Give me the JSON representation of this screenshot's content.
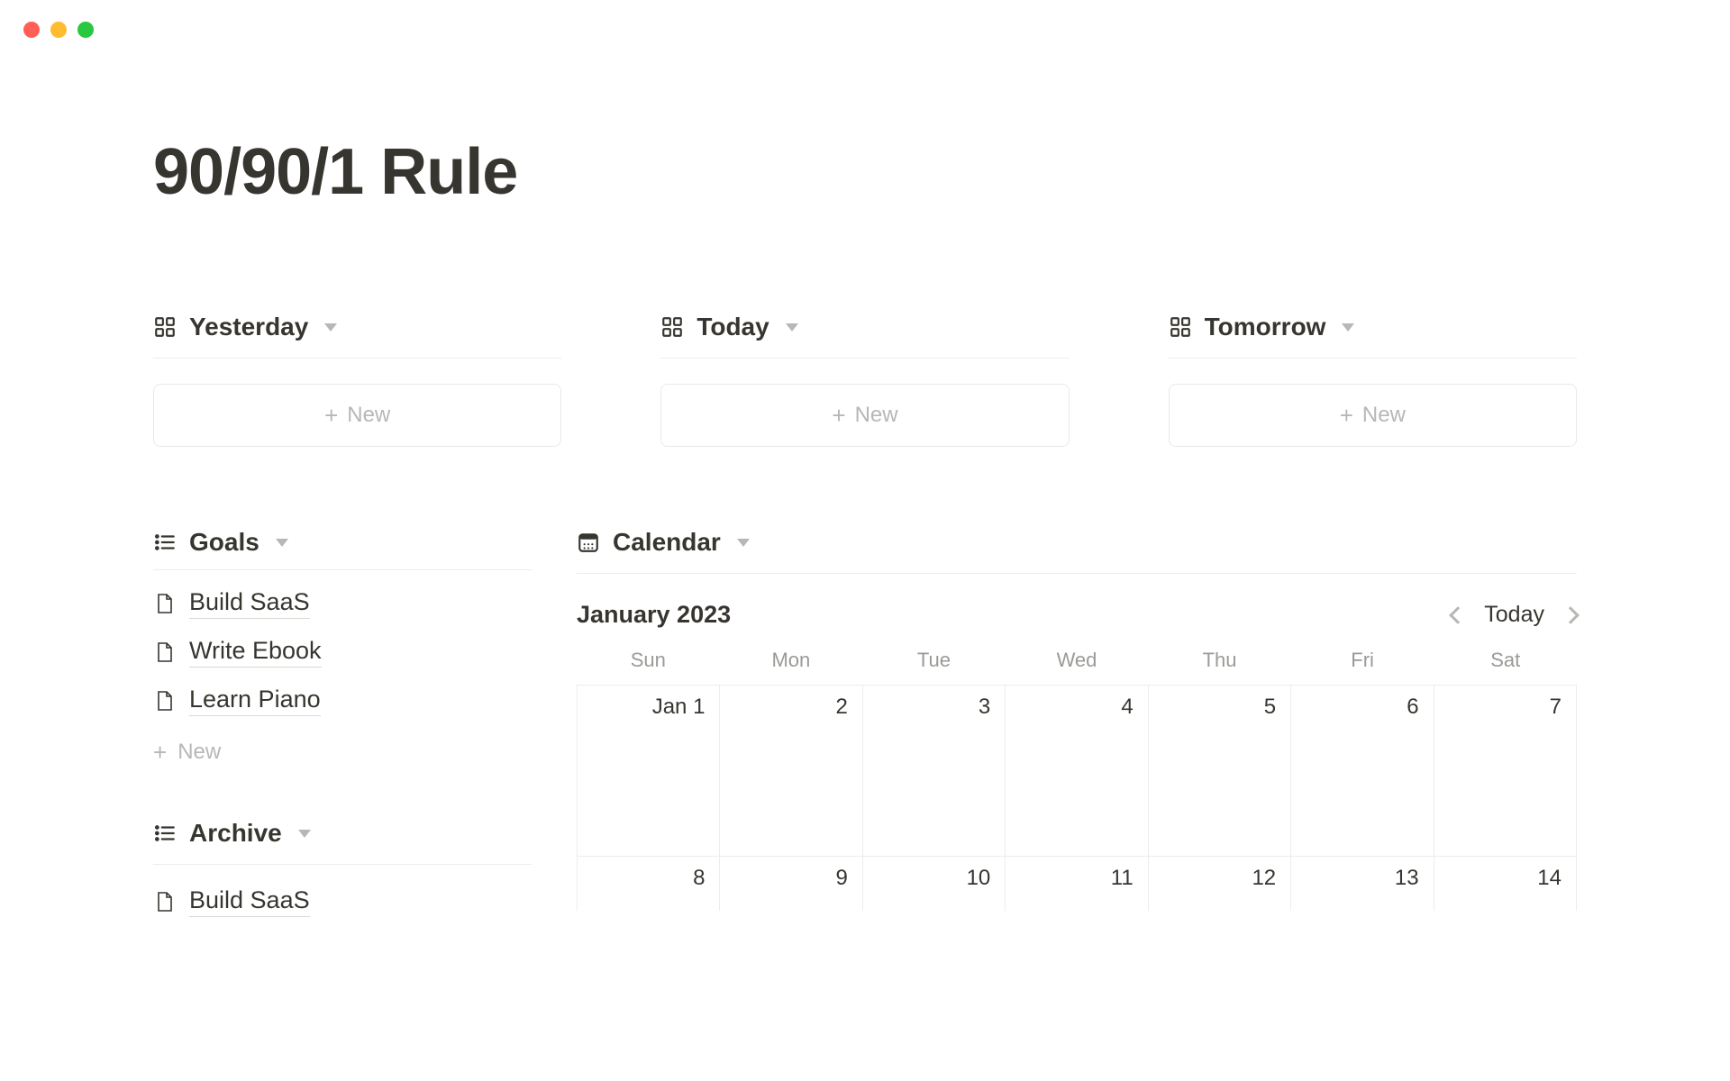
{
  "page_title": "90/90/1 Rule",
  "views": {
    "yesterday": {
      "label": "Yesterday",
      "new_label": "New"
    },
    "today": {
      "label": "Today",
      "new_label": "New"
    },
    "tomorrow": {
      "label": "Tomorrow",
      "new_label": "New"
    }
  },
  "goals": {
    "label": "Goals",
    "items": [
      {
        "title": "Build SaaS"
      },
      {
        "title": "Write Ebook"
      },
      {
        "title": "Learn Piano"
      }
    ],
    "new_label": "New"
  },
  "archive": {
    "label": "Archive",
    "items": [
      {
        "title": "Build SaaS"
      }
    ]
  },
  "calendar": {
    "label": "Calendar",
    "month_label": "January 2023",
    "today_label": "Today",
    "weekdays": [
      "Sun",
      "Mon",
      "Tue",
      "Wed",
      "Thu",
      "Fri",
      "Sat"
    ],
    "cells_row1": [
      "Jan 1",
      "2",
      "3",
      "4",
      "5",
      "6",
      "7"
    ],
    "cells_row2": [
      "8",
      "9",
      "10",
      "11",
      "12",
      "13",
      "14"
    ]
  }
}
